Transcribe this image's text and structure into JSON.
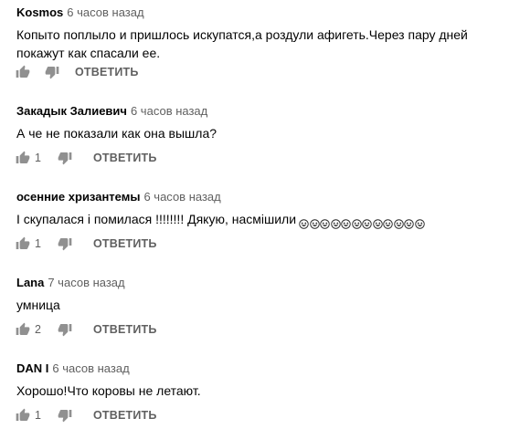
{
  "reply_label": "ОТВЕТИТЬ",
  "icons": {
    "like": "thumbs-up-icon",
    "dislike": "thumbs-down-icon",
    "emoji": "grinning-squinting-face-icon"
  },
  "colors": {
    "text": "#030303",
    "secondary": "#606060",
    "background": "#ffffff"
  },
  "comments": [
    {
      "author": "Kosmos",
      "time": "6 часов назад",
      "text": "Копыто поплыло и пришлось искупатся,а роздули афигеть.Через пару дней покажут как спасали ее.",
      "likes": ""
    },
    {
      "author": "Закадык Залиевич",
      "time": "6 часов назад",
      "text": "А че не показали как она вышла?",
      "likes": "1"
    },
    {
      "author": "осенние хризантемы",
      "time": "6 часов назад",
      "text": "І скупалася і помилася !!!!!!!! Дякую, насмішили",
      "emoji_count": 12,
      "likes": "1"
    },
    {
      "author": "Lana",
      "time": "7 часов назад",
      "text": "умница",
      "likes": "2"
    },
    {
      "author": "DAN I",
      "time": "6 часов назад",
      "text": "Хорошо!Что коровы не летают.",
      "likes": "1"
    }
  ]
}
